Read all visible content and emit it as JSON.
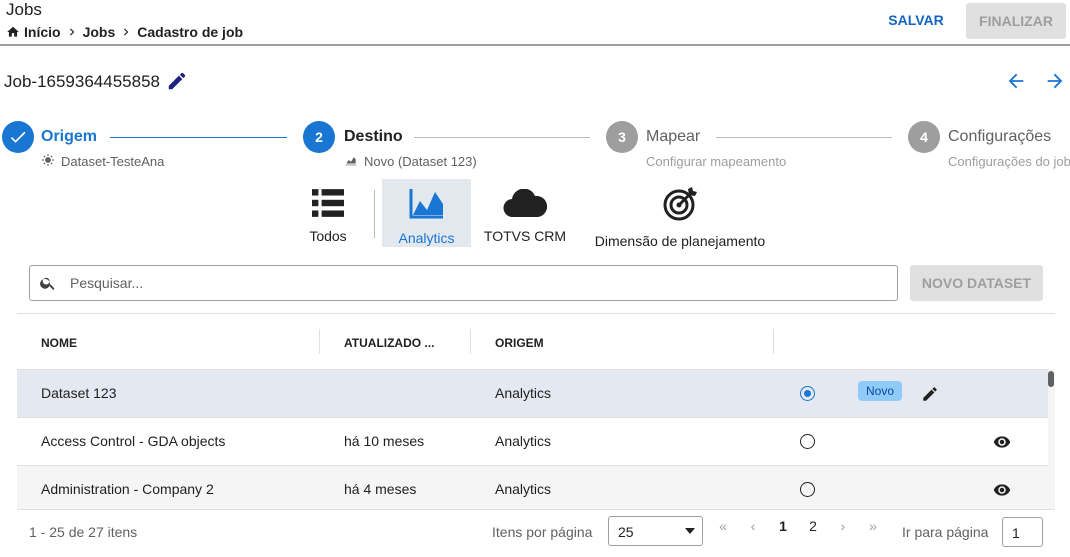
{
  "header": {
    "title": "Jobs",
    "breadcrumb": [
      "Início",
      "Jobs",
      "Cadastro de job"
    ],
    "save_label": "SALVAR",
    "finish_label": "FINALIZAR"
  },
  "job": {
    "name": "Job-1659364455858"
  },
  "stepper": [
    {
      "number": "",
      "title": "Origem",
      "subtitle": "Dataset-TesteAna",
      "state": "done"
    },
    {
      "number": "2",
      "title": "Destino",
      "subtitle": "Novo (Dataset 123)",
      "state": "active"
    },
    {
      "number": "3",
      "title": "Mapear",
      "subtitle": "Configurar mapeamento",
      "state": "pending"
    },
    {
      "number": "4",
      "title": "Configurações",
      "subtitle": "Configurações do job",
      "state": "pending"
    }
  ],
  "categories": [
    {
      "label": "Todos",
      "icon": "list-icon"
    },
    {
      "label": "Analytics",
      "icon": "analytics-icon",
      "active": true
    },
    {
      "label": "TOTVS CRM",
      "icon": "cloud-icon"
    },
    {
      "label": "Dimensão de planejamento",
      "icon": "target-icon"
    }
  ],
  "search": {
    "placeholder": "Pesquisar..."
  },
  "new_dataset_label": "NOVO DATASET",
  "table": {
    "columns": [
      "NOME",
      "ATUALIZADO ...",
      "ORIGEM"
    ],
    "rows": [
      {
        "name": "Dataset 123",
        "updated": "",
        "origin": "Analytics",
        "selected": true,
        "badge": "Novo"
      },
      {
        "name": "Access Control - GDA objects",
        "updated": "há 10 meses",
        "origin": "Analytics",
        "selected": false
      },
      {
        "name": "Administration - Company 2",
        "updated": "há 4 meses",
        "origin": "Analytics",
        "selected": false
      }
    ]
  },
  "footer": {
    "range": "1 - 25 de 27 itens",
    "per_page_label": "Itens por página",
    "per_page_value": "25",
    "pages": [
      "1",
      "2"
    ],
    "first": "«",
    "prev": "‹",
    "next": "›",
    "last": "»",
    "goto_label": "Ir para página",
    "goto_value": "1"
  },
  "colors": {
    "accent": "#1976d2",
    "selected_row": "#e3e8f1",
    "badge": "#90caf9",
    "disabled": "#e0e0e0"
  }
}
